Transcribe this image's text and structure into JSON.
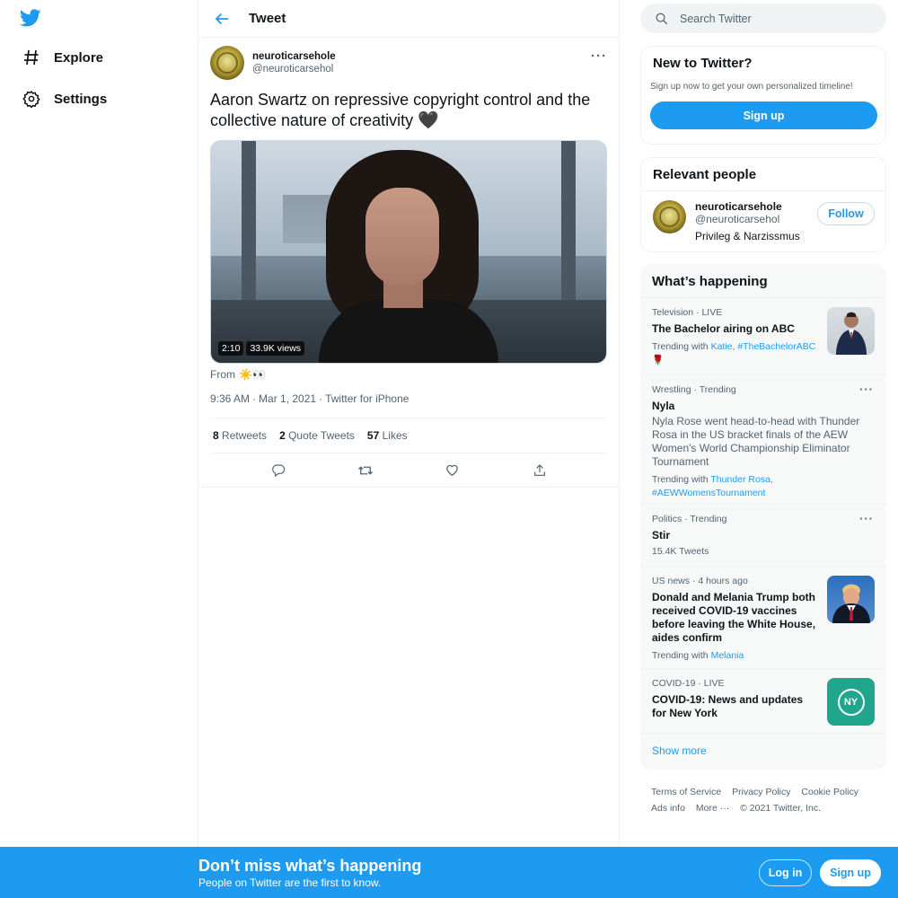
{
  "nav": {
    "items": [
      {
        "label": "Explore",
        "icon": "hashtag-icon"
      },
      {
        "label": "Settings",
        "icon": "gear-icon"
      }
    ]
  },
  "header": {
    "title": "Tweet"
  },
  "tweet": {
    "author_name": "neuroticarsehole",
    "author_handle": "@neuroticarsehol",
    "text": "Aaron Swartz on repressive copyright control and the collective nature of creativity",
    "text_emoji": "🖤",
    "video_duration": "2:10",
    "video_views": "33.9K views",
    "from_label": "From",
    "from_emoji": "☀️👀",
    "time": "9:36 AM",
    "date": "Mar 1, 2021",
    "client": "Twitter for iPhone",
    "stats": {
      "retweets": "8",
      "retweets_label": "Retweets",
      "quotes": "2",
      "quotes_label": "Quote Tweets",
      "likes": "57",
      "likes_label": "Likes"
    }
  },
  "search": {
    "placeholder": "Search Twitter"
  },
  "new_to_twitter": {
    "title": "New to Twitter?",
    "subtitle": "Sign up now to get your own personalized timeline!",
    "button": "Sign up"
  },
  "relevant_people": {
    "title": "Relevant people",
    "name": "neuroticarsehole",
    "handle": "@neuroticarsehol",
    "bio": "Privileg & Narzissmus",
    "follow": "Follow"
  },
  "happening": {
    "title": "What’s happening",
    "trends": [
      {
        "meta": "Television · LIVE",
        "title": "The Bachelor airing on ABC",
        "with_label": "Trending with",
        "tags": "Katie, #TheBachelorABC",
        "emoji": "🌹"
      },
      {
        "meta": "Wrestling · Trending",
        "title": "Nyla",
        "desc": "Nyla Rose went head-to-head with Thunder Rosa in the US bracket finals of the AEW Women's World Championship Eliminator Tournament",
        "with_label": "Trending with",
        "tags": "Thunder Rosa, #AEWWomensTournament"
      },
      {
        "meta": "Politics · Trending",
        "title": "Stir",
        "count": "15.4K Tweets"
      },
      {
        "meta": "US news · 4 hours ago",
        "title": "Donald and Melania Trump both received COVID-19 vaccines before leaving the White House, aides confirm",
        "with_label": "Trending with",
        "tags": "Melania"
      },
      {
        "meta": "COVID-19 · LIVE",
        "title": "COVID-19: News and updates for New York",
        "badge": "NY"
      }
    ],
    "show_more": "Show more"
  },
  "footer": {
    "links": [
      "Terms of Service",
      "Privacy Policy",
      "Cookie Policy",
      "Ads info",
      "More ···"
    ],
    "copyright": "© 2021 Twitter, Inc."
  },
  "bottom_bar": {
    "title": "Don’t miss what’s happening",
    "subtitle": "People on Twitter are the first to know.",
    "login": "Log in",
    "signup": "Sign up"
  },
  "colors": {
    "accent": "#1d9bf0",
    "text": "#0f1419",
    "muted": "#536471"
  }
}
